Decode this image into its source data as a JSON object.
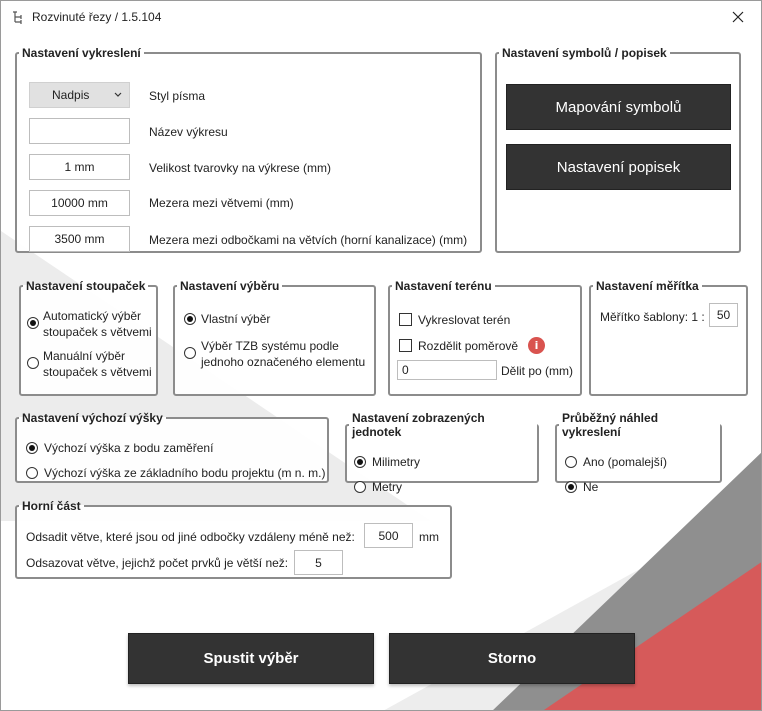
{
  "window": {
    "title": "Rozvinuté řezy / 1.5.104",
    "app_icon": "app-tree-icon",
    "close_icon": "close-icon"
  },
  "drawing_settings": {
    "legend": "Nastavení vykreslení",
    "font_style": {
      "value": "Nadpis",
      "label": "Styl písma"
    },
    "drawing_name": {
      "value": "",
      "label": "Název výkresu"
    },
    "fitting_size": {
      "value": "1 mm",
      "label": "Velikost tvarovky na výkrese (mm)"
    },
    "branch_gap": {
      "value": "10000 mm",
      "label": "Mezera mezi větvemi (mm)"
    },
    "junction_gap": {
      "value": "3500 mm",
      "label": "Mezera mezi odbočkami na větvích (horní kanalizace) (mm)"
    }
  },
  "symbol_settings": {
    "legend": "Nastavení symbolů / popisek",
    "mapping_button": "Mapování symbolů",
    "labels_button": "Nastavení popisek"
  },
  "risers": {
    "legend": "Nastavení stoupaček",
    "auto": "Automatický výběr stoupaček s větvemi",
    "manual": "Manuální výběr stoupaček s větvemi",
    "selected": "auto"
  },
  "selection": {
    "legend": "Nastavení výběru",
    "custom": "Vlastní výběr",
    "tzb": "Výběr TZB systému podle jednoho označeného elementu",
    "selected": "custom"
  },
  "terrain": {
    "legend": "Nastavení terénu",
    "draw_terrain": "Vykreslovat terén",
    "split_ratio": "Rozdělit poměrově",
    "divide_value": "0",
    "divide_label": "Dělit po (mm)",
    "info_icon": "info-icon",
    "info_glyph": "i"
  },
  "scale": {
    "legend": "Nastavení měřítka",
    "label": "Měřítko šablony: 1 :",
    "value": "50"
  },
  "default_height": {
    "legend": "Nastavení výchozí výšky",
    "from_survey": "Výchozí výška z bodu zaměření",
    "from_base": "Výchozí výška ze základního bodu projektu (m n. m.)",
    "selected": "from_survey"
  },
  "units": {
    "legend": "Nastavení zobrazených jednotek",
    "millimeters": "Milimetry",
    "meters": "Metry",
    "selected": "millimeters"
  },
  "preview": {
    "legend": "Průběžný náhled vykreslení",
    "yes": "Ano (pomalejší)",
    "no": "Ne",
    "selected": "no"
  },
  "top_part": {
    "legend": "Horní část",
    "offset_label": "Odsadit větve, které jsou od jiné odbočky vzdáleny méně než:",
    "offset_value": "500",
    "offset_unit": "mm",
    "count_label": "Odsazovat větve, jejichž počet prvků je větší než:",
    "count_value": "5"
  },
  "footer": {
    "run_button": "Spustit výběr",
    "cancel_button": "Storno"
  },
  "colors": {
    "dark_button": "#333333",
    "accent_red": "#d9534f",
    "deco_gray": "#8a8a8a",
    "deco_light": "#e6e6e6"
  }
}
